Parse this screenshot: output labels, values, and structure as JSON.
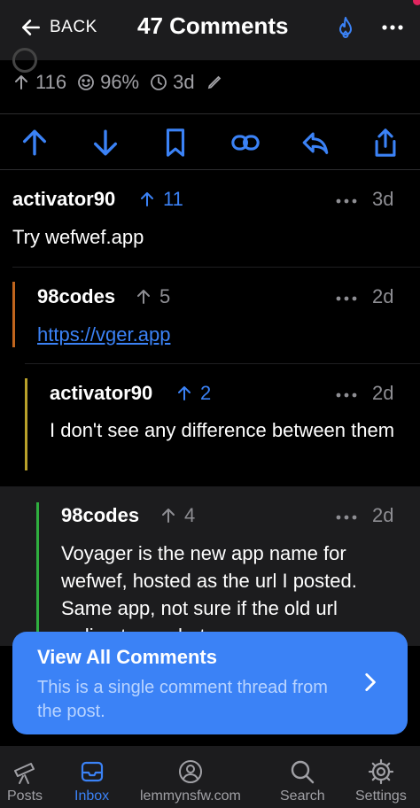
{
  "header": {
    "back_label": "BACK",
    "title": "47 Comments"
  },
  "post_meta": {
    "score": "116",
    "upvote_pct": "96%",
    "age": "3d"
  },
  "comments": [
    {
      "author": "activator90",
      "score": "11",
      "age": "3d",
      "body": "Try wefwef.app"
    },
    {
      "author": "98codes",
      "score": "5",
      "age": "2d",
      "body": "https://vger.app"
    },
    {
      "author": "activator90",
      "score": "2",
      "age": "2d",
      "body": "I don't see any difference between them"
    },
    {
      "author": "98codes",
      "score": "4",
      "age": "2d",
      "body": "Voyager is the new app name for wefwef, hosted as the url I posted. Same app, not sure if the old url redirects or what"
    }
  ],
  "cta": {
    "title": "View All Comments",
    "subtitle": "This is a single comment thread from the post."
  },
  "tabs": [
    {
      "label": "Posts",
      "icon": "telescope-icon"
    },
    {
      "label": "Inbox",
      "icon": "inbox-icon"
    },
    {
      "label": "lemmynsfw.com",
      "icon": "profile-icon"
    },
    {
      "label": "Search",
      "icon": "search-icon"
    },
    {
      "label": "Settings",
      "icon": "gear-icon"
    }
  ],
  "colors": {
    "accent": "#3b82f6",
    "background": "#000000",
    "bar_level1": "#c0651d",
    "bar_level2": "#b9a12a",
    "bar_level3": "#2fae3f"
  }
}
